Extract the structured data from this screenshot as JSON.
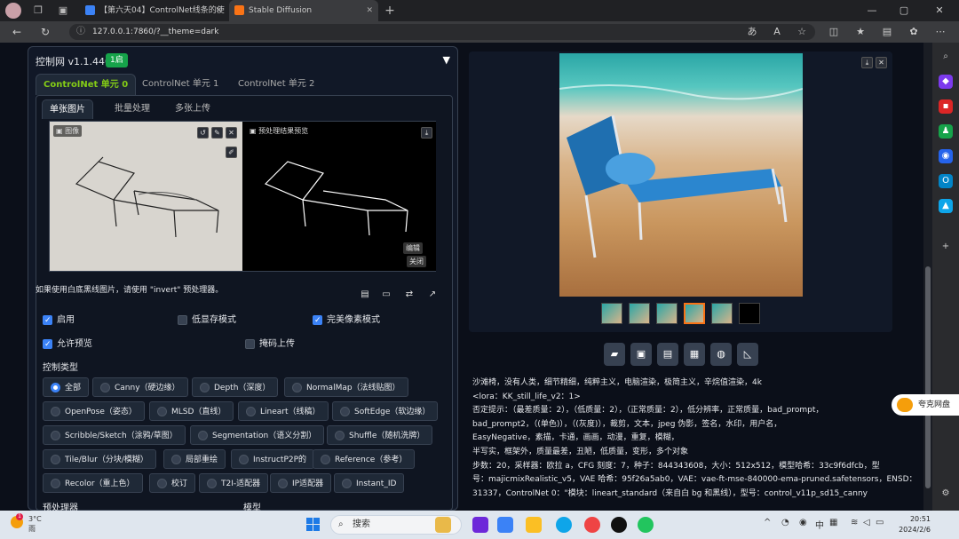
{
  "browser": {
    "tab1_title": "【第六天04】ControlNet线条的使",
    "tab2_title": "Stable Diffusion",
    "url": "127.0.0.1:7860/?__theme=dark",
    "new_tab": "+",
    "minimize": "—",
    "maximize": "▢",
    "close": "✕"
  },
  "controlnet": {
    "title": "控制网 v1.1.440",
    "badge": "1启",
    "collapse_icon": "▼",
    "unit_tabs": [
      "ControlNet 单元 0",
      "ControlNet 单元 1",
      "ControlNet 单元 2"
    ],
    "image_tabs": [
      "单张图片",
      "批量处理",
      "多张上传"
    ],
    "image_label": "图像",
    "preview_label": "预处理结果预览",
    "edit_btn": "编辑",
    "close_btn": "关闭",
    "hint": "如果使用白底黑线图片，请使用 \"invert\" 预处理器。",
    "enable": "启用",
    "lowvram": "低显存模式",
    "pixel_perfect": "完美像素模式",
    "allow_preview": "允许预览",
    "mask_upload": "掩码上传",
    "control_type_label": "控制类型",
    "control_types": [
      "全部",
      "Canny（硬边缘）",
      "Depth（深度）",
      "NormalMap（法线贴图）",
      "OpenPose（姿态）",
      "MLSD（直线）",
      "Lineart（线稿）",
      "SoftEdge（软边缘）",
      "Scribble/Sketch（涂鸦/草图）",
      "Segmentation（语义分割）",
      "Shuffle（随机洗牌）",
      "Tile/Blur（分块/模糊）",
      "局部重绘",
      "InstructP2P的",
      "Reference（参考）",
      "Recolor（重上色）",
      "校订",
      "T2I-适配器",
      "IP适配器",
      "Instant_ID"
    ],
    "preprocessor_label": "预处理器",
    "model_label": "模型"
  },
  "output": {
    "info_lines": [
      "沙滩椅，没有人类，细节精细，纯粹主义，电脑渲染，极简主义，辛烷值渲染，4k",
      "<lora：KK_still_life_v2：1>",
      "否定提示：（最差质量：2），（低质量：2），（正常质量：2），低分辨率，正常质量，bad_prompt，",
      "bad_prompt2，（(单色)），（(灰度)），裁剪，文本，jpeg 伪影，签名，水印，用户名，",
      "EasyNegative，素描，卡通，画画，动漫，重复，模糊，",
      "半写实，框架外，质量最差，丑陋，低质量，变形，多个对象",
      "步数：20，采样器：欧拉 a，CFG 刻度：7，种子：844343608，大小：512x512，模型哈希：33c9f6dfcb，型",
      "号：majicmixRealistic_v5，VAE 哈希：95f26a5ab0，VAE：vae-ft-mse-840000-ema-pruned.safetensors，ENSD：",
      "31337，ControlNet 0：\"模块：lineart_standard（来自白 bg 和黑线），型号：control_v11p_sd15_canny"
    ]
  },
  "floating_widget": "夸克网盘",
  "taskbar": {
    "temp": "3°C",
    "weather": "雨",
    "notif": "1",
    "search": "搜索",
    "time": "20:51",
    "date": "2024/2/6",
    "lang": "中"
  },
  "colors": {
    "accent_green": "#84cc16",
    "checkbox_blue": "#3b82f6",
    "selected_thumb": "#f97316"
  }
}
